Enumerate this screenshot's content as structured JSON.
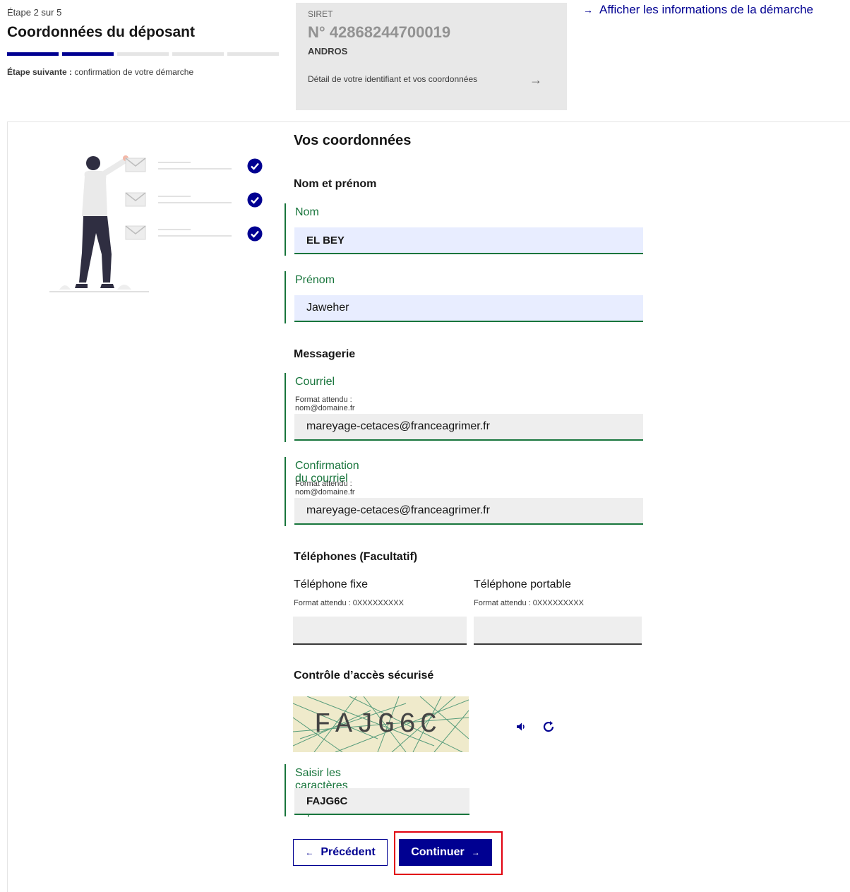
{
  "stepper": {
    "count": "Étape 2 sur 5",
    "title": "Coordonnées du déposant",
    "steps_total": 5,
    "steps_done": 2,
    "next_prefix": "Étape suivante :",
    "next_value": "confirmation de votre démarche"
  },
  "siret": {
    "label": "SIRET",
    "number": "N° 42868244700019",
    "company": "ANDROS",
    "detail": "Détail de votre identifiant et vos coordonnées"
  },
  "info_link": "Afficher les informations de la démarche",
  "form": {
    "title": "Vos coordonnées",
    "name_section": "Nom et prénom",
    "nom_label": "Nom",
    "nom_value": "EL BEY",
    "prenom_label": "Prénom",
    "prenom_value": "Jaweher",
    "mail_section": "Messagerie",
    "courriel_label": "Courriel",
    "courriel_hint": "Format attendu : nom@domaine.fr",
    "courriel_value": "mareyage-cetaces@franceagrimer.fr",
    "confirm_label": "Confirmation du courriel",
    "confirm_hint": "Format attendu : nom@domaine.fr",
    "confirm_value": "mareyage-cetaces@franceagrimer.fr",
    "phone_section": "Téléphones (Facultatif)",
    "fixe_label": "Téléphone fixe",
    "fixe_hint": "Format attendu : 0XXXXXXXXX",
    "fixe_value": "",
    "portable_label": "Téléphone portable",
    "portable_hint": "Format attendu : 0XXXXXXXXX",
    "portable_value": "",
    "captcha_section": "Contrôle d’accès sécurisé",
    "captcha_image_text": "FAJG6C",
    "captcha_label": "Saisir les caractères du captcha",
    "captcha_value": "FAJG6C"
  },
  "buttons": {
    "prev": "Précédent",
    "next": "Continuer"
  },
  "colors": {
    "primary": "#000091",
    "success": "#18753c",
    "highlight": "#e1000f"
  },
  "icons": [
    "arrow-right-icon",
    "audio-icon",
    "refresh-icon",
    "checkmark-icon",
    "arrow-left-icon"
  ]
}
